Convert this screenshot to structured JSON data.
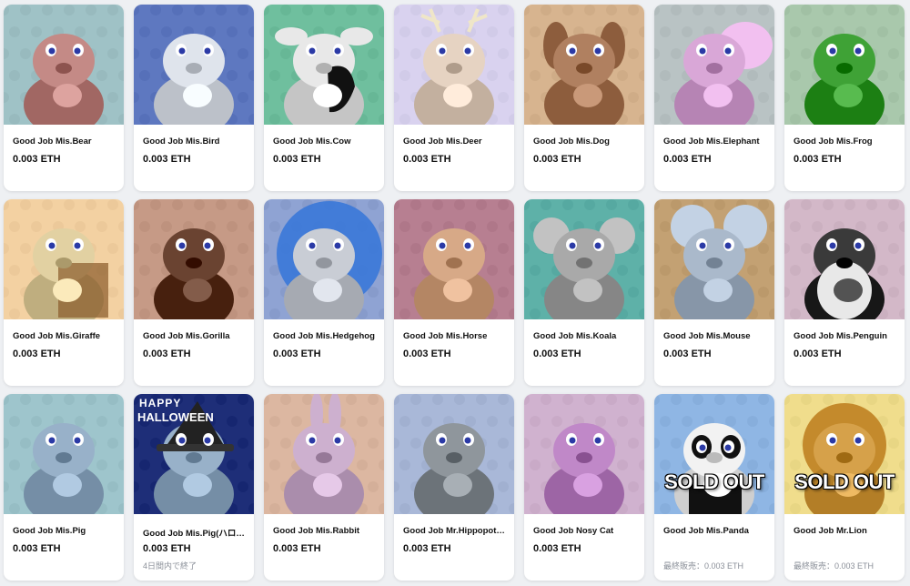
{
  "currency_unit": "ETH",
  "items": [
    {
      "name": "Good Job Mis.Bear",
      "price": "0.003 ETH",
      "bg": "#9fc2c6",
      "body": "#c48a86",
      "animal": "bear"
    },
    {
      "name": "Good Job Mis.Bird",
      "price": "0.003 ETH",
      "bg": "#5e78c0",
      "body": "#dfe4ec",
      "animal": "bird"
    },
    {
      "name": "Good Job Mis.Cow",
      "price": "0.003 ETH",
      "bg": "#6fbf9e",
      "body": "#e8e8e8",
      "animal": "cow"
    },
    {
      "name": "Good Job Mis.Deer",
      "price": "0.003 ETH",
      "bg": "#d9d2ef",
      "body": "#e6d3c2",
      "animal": "deer"
    },
    {
      "name": "Good Job Mis.Dog",
      "price": "0.003 ETH",
      "bg": "#d7b48f",
      "body": "#b08060",
      "animal": "dog"
    },
    {
      "name": "Good Job Mis.Elephant",
      "price": "0.003 ETH",
      "bg": "#b9c3c4",
      "body": "#d9a7d7",
      "animal": "elephant"
    },
    {
      "name": "Good Job Mis.Frog",
      "price": "0.003 ETH",
      "bg": "#a9c8ac",
      "body": "#3fa236",
      "animal": "frog"
    },
    {
      "name": "Good Job Mis.Giraffe",
      "price": "0.003 ETH",
      "bg": "#f3d1a2",
      "body": "#e2d1a2",
      "animal": "giraffe"
    },
    {
      "name": "Good Job Mis.Gorilla",
      "price": "0.003 ETH",
      "bg": "#c69a86",
      "body": "#6a4331",
      "animal": "gorilla"
    },
    {
      "name": "Good Job Mis.Hedgehog",
      "price": "0.003 ETH",
      "bg": "#8fa3d3",
      "body": "#c9cdd5",
      "animal": "hedgehog"
    },
    {
      "name": "Good Job Mis.Horse",
      "price": "0.003 ETH",
      "bg": "#b77f91",
      "body": "#d7a987",
      "animal": "horse"
    },
    {
      "name": "Good Job Mis.Koala",
      "price": "0.003 ETH",
      "bg": "#5eb1a8",
      "body": "#a9a9a9",
      "animal": "koala"
    },
    {
      "name": "Good Job Mis.Mouse",
      "price": "0.003 ETH",
      "bg": "#c3a173",
      "body": "#aab9cb",
      "animal": "mouse"
    },
    {
      "name": "Good Job Mis.Penguin",
      "price": "0.003 ETH",
      "bg": "#d3b8c8",
      "body": "#3a3a3a",
      "animal": "penguin"
    },
    {
      "name": "Good Job Mis.Pig",
      "price": "0.003 ETH",
      "bg": "#9ec5cc",
      "body": "#98b1c9",
      "animal": "pig"
    },
    {
      "name": "Good Job Mis.Pig(ハロ…",
      "price": "0.003 ETH",
      "bg": "#1e2e78",
      "body": "#98b1c9",
      "animal": "pig-halloween",
      "sub": "4日間内で終了",
      "halloween_text": "HAPPY HALLOWEEN"
    },
    {
      "name": "Good Job Mis.Rabbit",
      "price": "0.003 ETH",
      "bg": "#dcb7a1",
      "body": "#cdb0cf",
      "animal": "rabbit"
    },
    {
      "name": "Good Job Mr.Hippopot…",
      "price": "0.003 ETH",
      "bg": "#a9b8d8",
      "body": "#8f969c",
      "animal": "hippo"
    },
    {
      "name": "Good Job Nosy Cat",
      "price": "0.003 ETH",
      "bg": "#d0b2cf",
      "body": "#c088c8",
      "animal": "cat"
    },
    {
      "name": "Good Job Mis.Panda",
      "price": "",
      "bg": "#8fb6e4",
      "body": "#f2f2f2",
      "animal": "panda",
      "sold_out": "SOLD OUT",
      "last_sale": "最終販売：0.003 ETH"
    },
    {
      "name": "Good Job Mr.Lion",
      "price": "",
      "bg": "#f0dd8c",
      "body": "#d6a14a",
      "animal": "lion",
      "sold_out": "SOLD OUT",
      "last_sale": "最終販売：0.003 ETH"
    }
  ]
}
